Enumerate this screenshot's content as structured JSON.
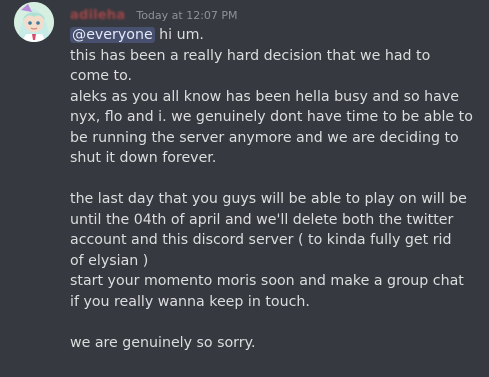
{
  "message": {
    "author": "adileha",
    "timestamp": "Today at 12:07 PM",
    "mention": "@everyone",
    "first_line_rest": " hi um.",
    "lines": [
      "this has been a really hard decision that we had to",
      "come to.",
      "aleks as you all know has been hella busy and so have",
      "nyx, flo and i. we genuinely dont have time to be able to",
      "be running the server anymore and we are deciding to",
      "shut it down forever.",
      "",
      "the last day that you guys will be able to play on will be",
      "until the 04th of april and we'll delete both the twitter",
      "account and this discord server ( to kinda fully get rid",
      "of elysian )",
      "start your momento moris soon and make a group chat",
      "if you really wanna keep in touch.",
      "",
      "we are genuinely so sorry."
    ]
  }
}
